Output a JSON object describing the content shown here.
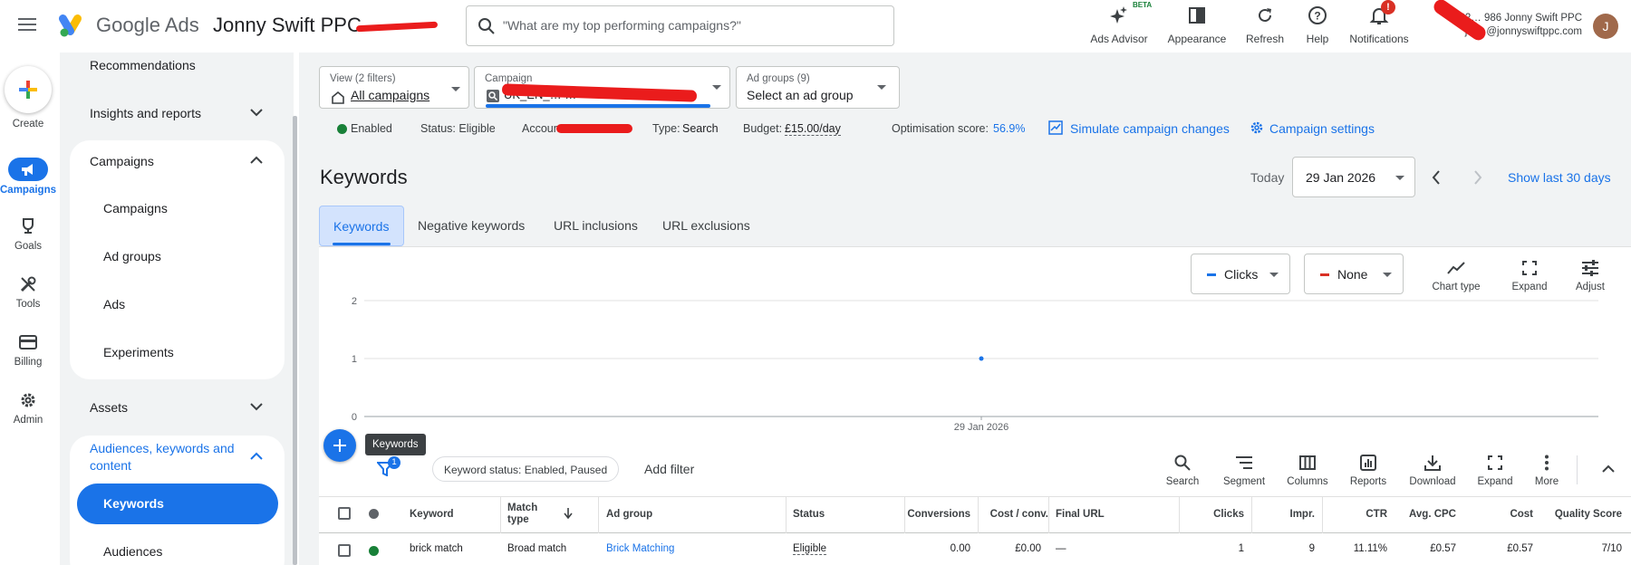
{
  "header": {
    "brand_google": "Google",
    "brand_ads": "Ads",
    "account_name": "Jonny Swift PPC",
    "search_placeholder": "\"What are my top performing campaigns?\"",
    "tools": [
      {
        "label": "Ads Advisor",
        "badge": "BETA",
        "icon": "sparkle-icon"
      },
      {
        "label": "Appearance",
        "icon": "appearance-icon"
      },
      {
        "label": "Refresh",
        "icon": "refresh-icon"
      },
      {
        "label": "Help",
        "icon": "help-icon"
      },
      {
        "label": "Notifications",
        "badge": "!",
        "icon": "bell-icon"
      }
    ],
    "account_line1": "22… 986 Jonny Swift PPC",
    "account_line2": "jo… @jonnyswiftppc.com",
    "avatar_letter": "J"
  },
  "rail": {
    "create": "Create",
    "items": [
      {
        "label": "Campaigns",
        "icon": "megaphone-icon",
        "active": true
      },
      {
        "label": "Goals",
        "icon": "trophy-icon"
      },
      {
        "label": "Tools",
        "icon": "tools-icon"
      },
      {
        "label": "Billing",
        "icon": "card-icon"
      },
      {
        "label": "Admin",
        "icon": "gear-icon"
      }
    ]
  },
  "sidebar": {
    "recommendations": "Recommendations",
    "insights": "Insights and reports",
    "campaigns_section": "Campaigns",
    "campaigns_items": [
      "Campaigns",
      "Ad groups",
      "Ads",
      "Experiments"
    ],
    "assets": "Assets",
    "audiences_section": "Audiences, keywords and content",
    "audiences_items": [
      "Keywords",
      "Audiences"
    ]
  },
  "selectors": {
    "view_label": "View (2 filters)",
    "view_value": "All campaigns",
    "campaign_label": "Campaign",
    "campaign_value": "UK_EN_… …",
    "adgroups_label": "Ad groups (9)",
    "adgroups_value": "Select an ad group"
  },
  "status_bar": {
    "enabled": "Enabled",
    "status": "Status: Eligible",
    "account": "Account:",
    "type_label": "Type:",
    "type_value": "Search",
    "budget_label": "Budget:",
    "budget_value": "£15.00/day",
    "opt_label": "Optimisation score:",
    "opt_value": "56.9%",
    "simulate": "Simulate campaign changes",
    "settings": "Campaign settings"
  },
  "page": {
    "title": "Keywords",
    "today": "Today",
    "date": "29 Jan 2026",
    "show_last": "Show last 30 days"
  },
  "tabs": [
    "Keywords",
    "Negative keywords",
    "URL inclusions",
    "URL exclusions"
  ],
  "chart_controls": {
    "metric1": "Clicks",
    "metric2": "None",
    "chart_type": "Chart type",
    "expand": "Expand",
    "adjust": "Adjust",
    "color1": "#1a73e8",
    "color2": "#d93025"
  },
  "chart_data": {
    "type": "line",
    "x": [
      "29 Jan 2026"
    ],
    "series": [
      {
        "values": [
          1
        ]
      }
    ],
    "ylim": [
      0,
      2
    ],
    "yticks": [
      "2",
      "1",
      "0"
    ],
    "xticks": [
      "29 Jan 2026"
    ],
    "grid": true
  },
  "tooltip": "Keywords",
  "filter": {
    "badge": "1",
    "chip": "Keyword status: Enabled, Paused",
    "add": "Add filter"
  },
  "table_tools": [
    {
      "label": "Search",
      "icon": "search-icon"
    },
    {
      "label": "Segment",
      "icon": "segment-icon"
    },
    {
      "label": "Columns",
      "icon": "columns-icon"
    },
    {
      "label": "Reports",
      "icon": "reports-icon"
    },
    {
      "label": "Download",
      "icon": "download-icon"
    },
    {
      "label": "Expand",
      "icon": "expand-icon"
    },
    {
      "label": "More",
      "icon": "more-icon"
    }
  ],
  "table": {
    "headers": {
      "keyword": "Keyword",
      "match_type_1": "Match",
      "match_type_2": "type",
      "ad_group": "Ad group",
      "status": "Status",
      "conversions": "Conversions",
      "cost_conv": "Cost / conv.",
      "final_url": "Final URL",
      "clicks": "Clicks",
      "impr": "Impr.",
      "ctr": "CTR",
      "avg_cpc": "Avg. CPC",
      "cost": "Cost",
      "quality": "Quality Score"
    },
    "rows": [
      {
        "keyword": "brick match",
        "match_type": "Broad match",
        "ad_group": "Brick Matching",
        "status": "Eligible",
        "conversions": "0.00",
        "cost_conv": "£0.00",
        "final_url": "—",
        "clicks": "1",
        "impr": "9",
        "ctr": "11.11%",
        "avg_cpc": "£0.57",
        "cost": "£0.57",
        "quality": "7/10"
      }
    ]
  }
}
